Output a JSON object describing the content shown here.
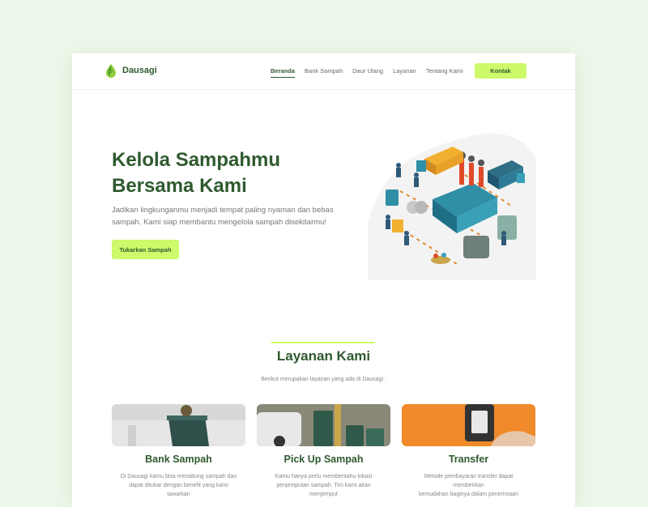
{
  "brand": {
    "name": "Dausagi",
    "logo_icon": "leaf-drop-icon"
  },
  "nav": {
    "items": [
      {
        "label": "Beranda",
        "active": true
      },
      {
        "label": "Bank Sampah",
        "active": false
      },
      {
        "label": "Daur Ulang",
        "active": false
      },
      {
        "label": "Layanan",
        "active": false
      },
      {
        "label": "Tentang Kami",
        "active": false
      }
    ],
    "contact_label": "Kontak"
  },
  "hero": {
    "title_line1": "Kelola Sampahmu",
    "title_line2": "Bersama Kami",
    "description_line1": "Jadikan lingkunganmu menjadi tempat paling nyaman dan bebas",
    "description_line2": "sampah. Kami siap membantu mengelola sampah disekitarmu!",
    "button_label": "Tukarkan Sampah"
  },
  "services": {
    "title": "Layanan Kami",
    "subtitle": "Berikut merupakan layanan yang ada di Dausagi :",
    "cards": [
      {
        "title": "Bank Sampah",
        "desc_line1": "Di Dausagi kamu bisa menabung sampah dan",
        "desc_line2": "dapat ditukar dengan benefit yang kami tawarkan"
      },
      {
        "title": "Pick Up Sampah",
        "desc_line1": "Kamu hanya perlu memberitahu lokasi",
        "desc_line2": "penjemputan sampah. Tim kami akan menjemput"
      },
      {
        "title": "Transfer",
        "desc_line1": "Metode pembayaran transfer dapat memberikan",
        "desc_line2": "kemudahan baginya dalam penerimaan"
      }
    ]
  },
  "colors": {
    "primary": "#2f5a2f",
    "accent": "#cdf96a",
    "background": "#eef8ea"
  }
}
